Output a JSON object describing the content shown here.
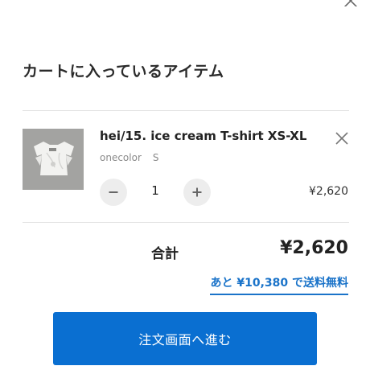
{
  "cart": {
    "title": "カートに入っているアイテム"
  },
  "item": {
    "name": "hei/15. ice cream T-shirt XS-XL",
    "color": "onecolor",
    "size": "S",
    "quantity": "1",
    "price": "¥2,620",
    "image": "white ice cream t-shirt laid flat on grey background"
  },
  "summary": {
    "total_label": "合計",
    "total_value": "¥2,620",
    "free_shipping_text": "あと ¥10,380 で送料無料"
  },
  "checkout": {
    "label": "注文画面へ進む"
  },
  "icons": {
    "close": "close-icon",
    "remove": "close-icon",
    "decrease": "minus-icon",
    "increase": "plus-icon"
  },
  "colors": {
    "accent": "#0a6fd1",
    "link": "#1a73c9",
    "qty_button_bg": "#ededed",
    "divider": "#e3e3e3"
  }
}
